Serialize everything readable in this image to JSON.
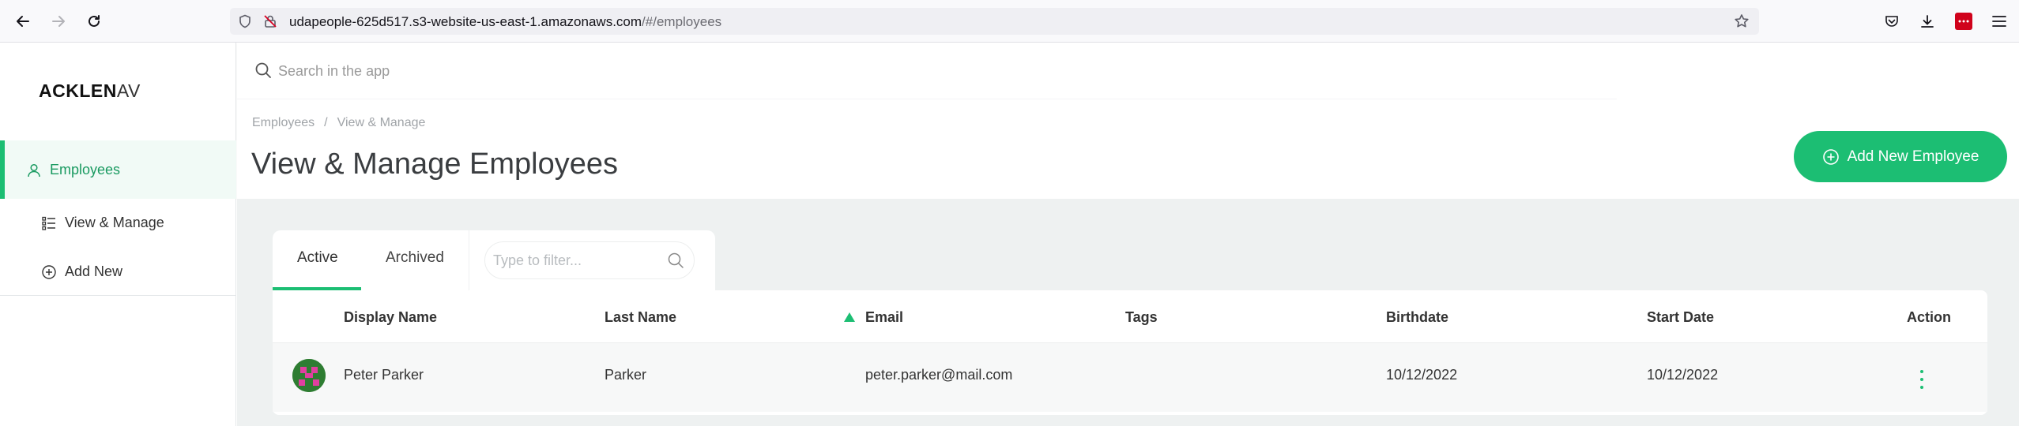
{
  "browser": {
    "url_host": "udapeople-625d517.s3-website-us-east-1.amazonaws.com",
    "url_path": "/#/employees"
  },
  "sidebar": {
    "logo_bold": "ACKLEN",
    "logo_light": "AV",
    "items": [
      {
        "label": "Employees",
        "icon": "user-icon",
        "active": true
      },
      {
        "label": "View & Manage",
        "icon": "list-icon",
        "active": false
      },
      {
        "label": "Add New",
        "icon": "plus-circle-icon",
        "active": false
      }
    ]
  },
  "header": {
    "search_placeholder": "Search in the app",
    "breadcrumb": [
      "Employees",
      "View & Manage"
    ],
    "breadcrumb_sep": "/",
    "title": "View & Manage Employees",
    "add_button_label": "Add New Employee"
  },
  "tabs": [
    {
      "label": "Active",
      "active": true
    },
    {
      "label": "Archived",
      "active": false
    }
  ],
  "filter_placeholder": "Type to filter...",
  "table": {
    "columns": [
      "Display Name",
      "Last Name",
      "Email",
      "Tags",
      "Birthdate",
      "Start Date",
      "Action"
    ],
    "sorted_column": "Email",
    "rows": [
      {
        "display_name": "Peter Parker",
        "last_name": "Parker",
        "email": "peter.parker@mail.com",
        "tags": "",
        "birthdate": "10/12/2022",
        "start_date": "10/12/2022"
      }
    ]
  },
  "colors": {
    "accent": "#1cbe73",
    "active_bg": "#f1faf6",
    "content_bg": "#eef1f1"
  }
}
